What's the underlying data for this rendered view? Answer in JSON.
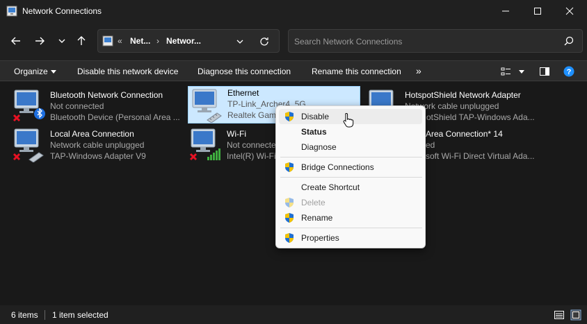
{
  "window": {
    "title": "Network Connections"
  },
  "address": {
    "crumbs": [
      "Net...",
      "Networ..."
    ]
  },
  "search": {
    "placeholder": "Search Network Connections"
  },
  "toolbar": {
    "organize": "Organize",
    "disable": "Disable this network device",
    "diagnose": "Diagnose this connection",
    "rename": "Rename this connection",
    "more": "»"
  },
  "connections": [
    {
      "name": "Bluetooth Network Connection",
      "status": "Not connected",
      "device": "Bluetooth Device (Personal Area ..."
    },
    {
      "name": "Ethernet",
      "status": "TP-Link_Archer4_5G",
      "device": "Realtek Gami"
    },
    {
      "name": "HotspotShield Network Adapter",
      "status": "Network cable unplugged",
      "device": "otShield TAP-Windows Ada..."
    },
    {
      "name": "Local Area Connection",
      "status": "Network cable unplugged",
      "device": "TAP-Windows Adapter V9"
    },
    {
      "name": "Wi-Fi",
      "status": "Not connecte",
      "device": "Intel(R) Wi-Fi"
    },
    {
      "name": "Area Connection* 14",
      "status": "ed",
      "device": "soft Wi-Fi Direct Virtual Ada..."
    }
  ],
  "context_menu": {
    "items": [
      {
        "label": "Disable"
      },
      {
        "label": "Status"
      },
      {
        "label": "Diagnose"
      },
      {
        "label": "Bridge Connections"
      },
      {
        "label": "Create Shortcut"
      },
      {
        "label": "Delete"
      },
      {
        "label": "Rename"
      },
      {
        "label": "Properties"
      }
    ]
  },
  "status": {
    "count": "6 items",
    "selected": "1 item selected"
  },
  "colors": {
    "accent": "#0078d4",
    "selection": "#cce8ff",
    "background": "#191919",
    "error_x": "#e81123"
  }
}
